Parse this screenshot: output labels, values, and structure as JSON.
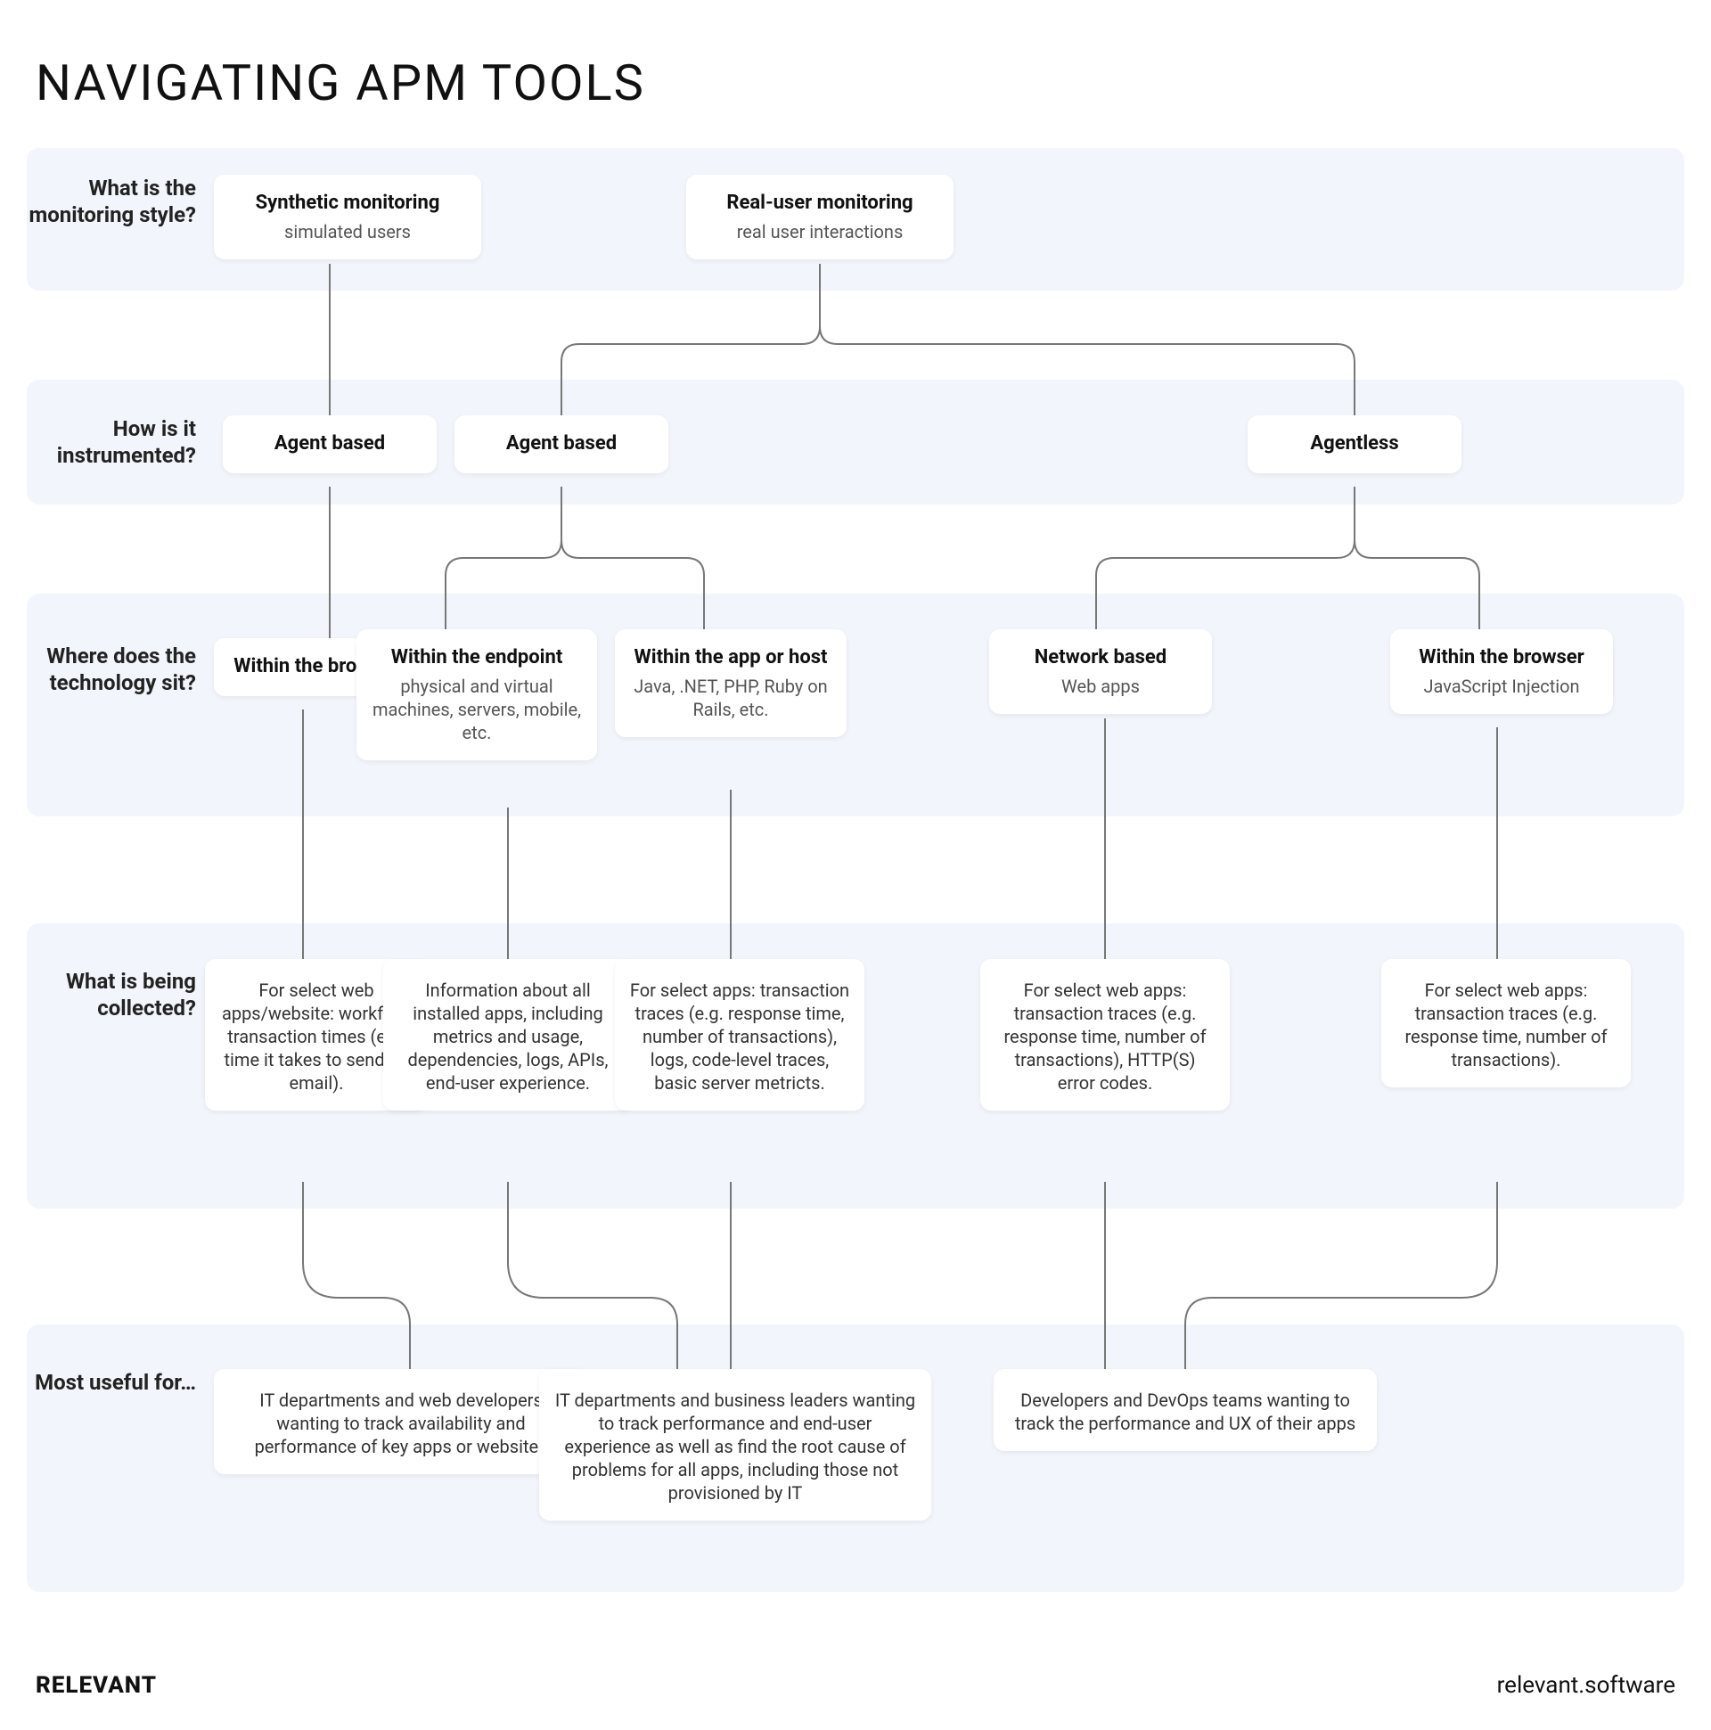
{
  "title": "NAVIGATING APM TOOLS",
  "rows": {
    "r1": {
      "question": "What is the monitoring style?"
    },
    "r2": {
      "question": "How is it instrumented?"
    },
    "r3": {
      "question": "Where does the technology sit?"
    },
    "r4": {
      "question": "What is being collected?"
    },
    "r5": {
      "question": "Most useful for…"
    }
  },
  "nodes": {
    "r1a": {
      "title": "Synthetic monitoring",
      "sub": "simulated users"
    },
    "r1b": {
      "title": "Real-user monitoring",
      "sub": "real user interactions"
    },
    "r2a": {
      "title": "Agent based"
    },
    "r2b": {
      "title": "Agent based"
    },
    "r2c": {
      "title": "Agentless"
    },
    "r3a": {
      "title": "Within the browser"
    },
    "r3b": {
      "title": "Within the endpoint",
      "sub": "physical and virtual machines, servers, mobile, etc."
    },
    "r3c": {
      "title": "Within the app or host",
      "sub": "Java, .NET, PHP, Ruby on Rails, etc."
    },
    "r3d": {
      "title": "Network based",
      "sub": "Web apps"
    },
    "r3e": {
      "title": "Within the browser",
      "sub": "JavaScript Injection"
    },
    "r4a": {
      "sub": "For select web apps/website: workflow transaction times (e.g. time it takes to send an email)."
    },
    "r4b": {
      "sub": "Information about all installed apps, including metrics and usage, dependencies, logs, APIs, end-user experience."
    },
    "r4c": {
      "sub": "For select apps: transaction traces (e.g. response time, number of transactions), logs, code-level traces, basic server metricts."
    },
    "r4d": {
      "sub": "For select web apps: transaction traces (e.g. response time, number of transactions), HTTP(S) error codes."
    },
    "r4e": {
      "sub": "For select web apps: transaction traces (e.g. response time, number of transactions)."
    },
    "r5a": {
      "sub": "IT departments and web developers wanting to track availability and performance of key apps or websites"
    },
    "r5b": {
      "sub": "IT departments and business leaders wanting to track performance and end-user experience as well as find the root cause of problems for all apps, including those not provisioned by IT"
    },
    "r5c": {
      "sub": "Developers and DevOps teams wanting to track the performance and UX of their apps"
    }
  },
  "footer": {
    "brand": "RELEVANT",
    "url": "relevant.software"
  }
}
